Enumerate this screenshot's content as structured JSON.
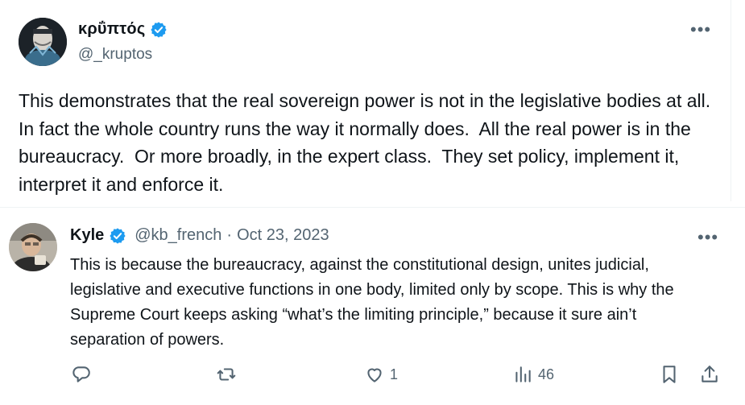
{
  "main_tweet": {
    "display_name": "κρΰπτός",
    "handle": "@_kruptos",
    "more_label": "•••",
    "text": "This demonstrates that the real sovereign power is not in the legislative bodies at all.  In fact the whole country runs the way it normally does.  All the real power is in the bureaucracy.  Or more broadly, in the expert class.  They set policy, implement it, interpret it and enforce it.",
    "verified_color": "#1d9bf0"
  },
  "reply": {
    "display_name": "Kyle",
    "handle": "@kb_french",
    "separator": "·",
    "date": "Oct 23, 2023",
    "more_label": "•••",
    "text": "This is because the bureaucracy, against the constitutional design, unites judicial, legislative and executive functions in one body, limited only by scope. This is why the Supreme Court keeps asking “what’s the limiting principle,” because it sure ain’t separation of powers.",
    "actions": {
      "reply_count": "",
      "retweet_count": "",
      "like_count": "1",
      "views_count": "46"
    },
    "icons": [
      "reply-icon",
      "retweet-icon",
      "like-icon",
      "views-icon",
      "bookmark-icon",
      "share-icon"
    ]
  }
}
